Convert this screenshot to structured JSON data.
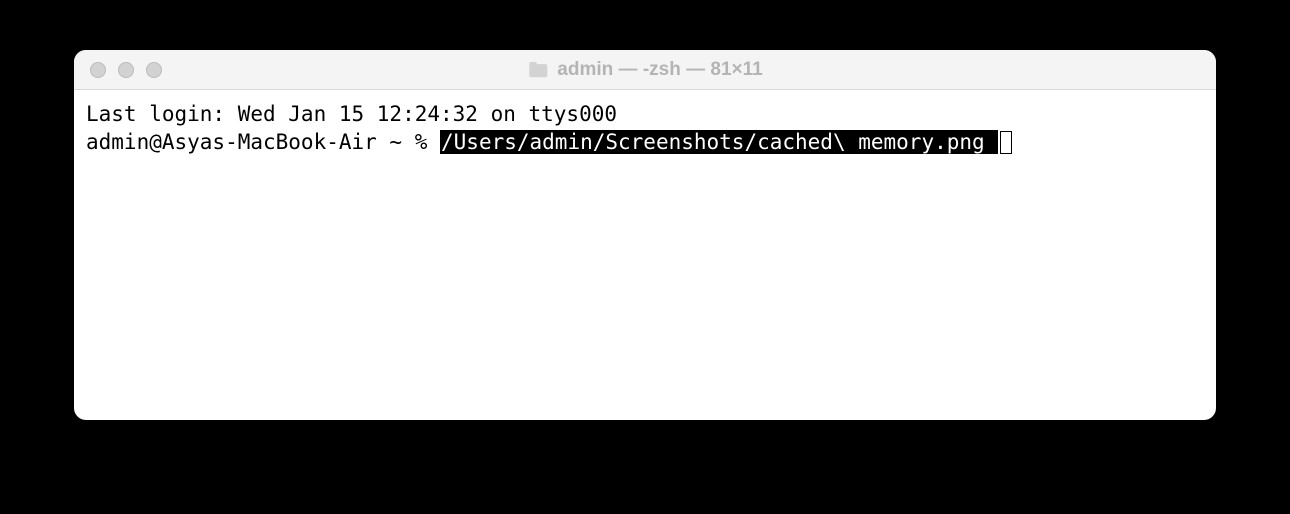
{
  "window": {
    "title": "admin — -zsh — 81×11"
  },
  "terminal": {
    "last_login": "Last login: Wed Jan 15 12:24:32 on ttys000",
    "prompt": "admin@Asyas-MacBook-Air ~ % ",
    "command": "/Users/admin/Screenshots/cached\\ memory.png "
  }
}
